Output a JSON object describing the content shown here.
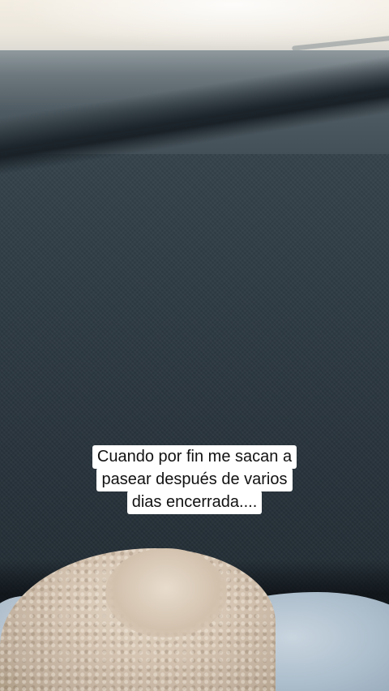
{
  "caption": {
    "lines": [
      "Cuando por fin me sacan a",
      "pasear después de varios",
      "dias encerrada...."
    ]
  },
  "scene": {
    "colors": {
      "dashboard": "#2e3a42",
      "windshield": "#ece7dd",
      "fur": "#d4c3b0",
      "blanket": "#aebfcd",
      "caption_bg": "#ffffff",
      "caption_text": "#111111"
    }
  }
}
